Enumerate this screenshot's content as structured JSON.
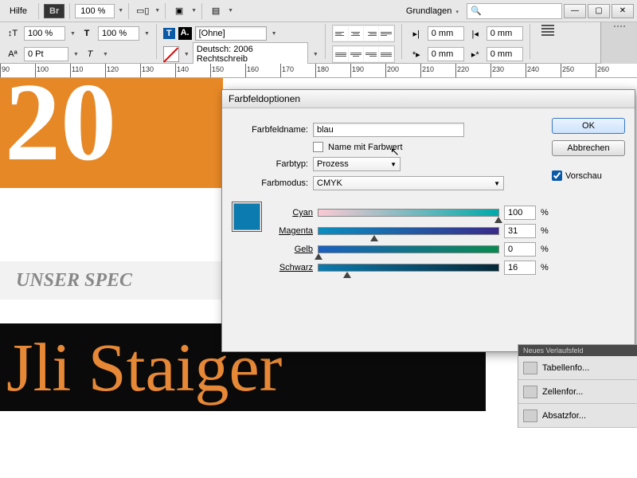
{
  "menubar": {
    "help": "Hilfe",
    "br": "Br",
    "zoom": "100 %",
    "workspace": "Grundlagen"
  },
  "toolbar": {
    "pct1": "100 %",
    "pct2": "100 %",
    "pt": "0 Pt",
    "ohne": "[Ohne]",
    "language": "Deutsch: 2006 Rechtschreib",
    "mm0": "0 mm"
  },
  "ruler": [
    "90",
    "100",
    "110",
    "120",
    "130",
    "140",
    "150",
    "160",
    "170",
    "180",
    "190",
    "200",
    "210",
    "220",
    "230",
    "240",
    "250",
    "260"
  ],
  "canvas": {
    "big": "20",
    "gray": "UNSER SPEC",
    "name": "Jli Staiger"
  },
  "dialog": {
    "title": "Farbfeldoptionen",
    "name_label": "Farbfeldname:",
    "name_value": "blau",
    "name_with_value": "Name mit Farbwert",
    "type_label": "Farbtyp:",
    "type_value": "Prozess",
    "mode_label": "Farbmodus:",
    "mode_value": "CMYK",
    "ok": "OK",
    "cancel": "Abbrechen",
    "preview": "Vorschau",
    "sliders": {
      "cyan_label": "Cyan",
      "cyan": "100",
      "magenta_label": "Magenta",
      "magenta": "31",
      "yellow_label": "Gelb",
      "yellow": "0",
      "black_label": "Schwarz",
      "black": "16"
    },
    "pct": "%"
  },
  "side": {
    "strip": "Neues Verlaufsfeld",
    "tabellen": "Tabellenfo...",
    "zellen": "Zellenfor...",
    "absatz": "Absatzfor..."
  }
}
